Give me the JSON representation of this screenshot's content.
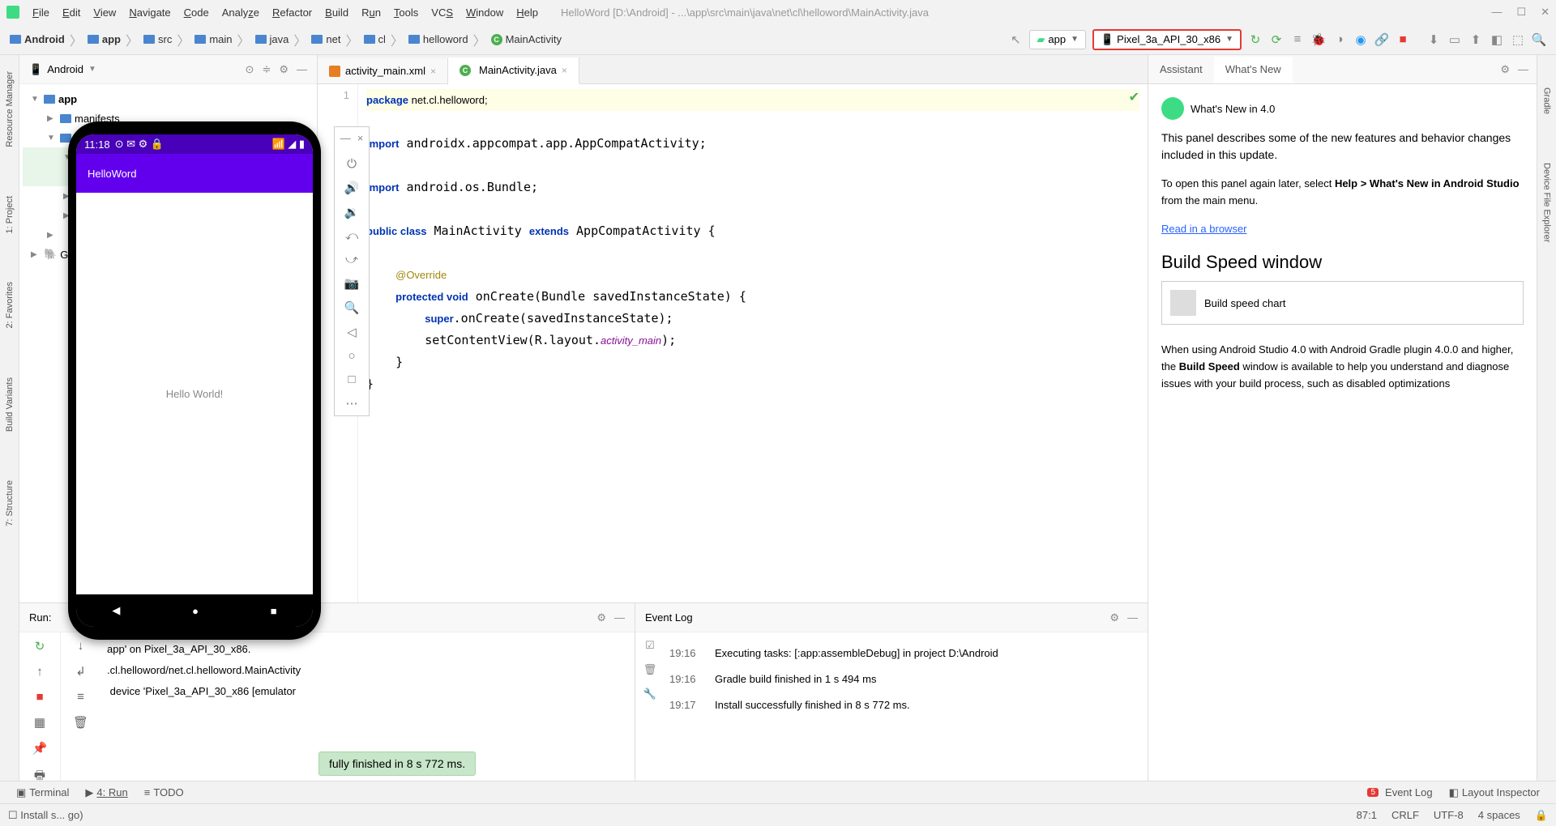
{
  "window": {
    "title": "HelloWord [D:\\Android] - ...\\app\\src\\main\\java\\net\\cl\\helloword\\MainActivity.java"
  },
  "menu": [
    "File",
    "Edit",
    "View",
    "Navigate",
    "Code",
    "Analyze",
    "Refactor",
    "Build",
    "Run",
    "Tools",
    "VCS",
    "Window",
    "Help"
  ],
  "breadcrumbs": [
    "Android",
    "app",
    "src",
    "main",
    "java",
    "net",
    "cl",
    "helloword",
    "MainActivity"
  ],
  "run_config": {
    "app": "app",
    "device": "Pixel_3a_API_30_x86"
  },
  "project": {
    "view": "Android",
    "root": "app",
    "manifests": "manifests"
  },
  "tabs": {
    "xml": "activity_main.xml",
    "java": "MainActivity.java"
  },
  "code": {
    "line1": "package net.cl.helloword;",
    "imp1": "import androidx.appcompat.app.AppCompatActivity;",
    "imp2": "import android.os.Bundle;",
    "cls": "public class MainActivity extends AppCompatActivity {",
    "ov": "@Override",
    "oc": "protected void onCreate(Bundle savedInstanceState) {",
    "sup": "super.onCreate(savedInstanceState);",
    "scv1": "setContentView(R.layout.",
    "scv2": "activity_main",
    "scv3": ");"
  },
  "gutter": "1",
  "whats_new": {
    "tab1": "Assistant",
    "tab2": "What's New",
    "h1": "What's New in 4.0",
    "p1": "This panel describes some of the new features and behavior changes included in this update.",
    "p2a": "To open this panel again later, select ",
    "p2b": "Help > What's New in Android Studio",
    "p2c": " from the main menu.",
    "link": "Read in a browser",
    "h2": "Build Speed window",
    "chart": "Build speed chart",
    "p3a": "When using Android Studio 4.0 with Android Gradle plugin 4.0.0 and higher, the ",
    "p3b": "Build Speed",
    "p3c": " window is available to help you understand and diagnose issues with your build process, such as disabled optimizations"
  },
  "run": {
    "title": "Run:",
    "l1": "app' on Pixel_3a_API_30_x86.",
    "l2": ".cl.helloword/net.cl.helloword.MainActivity",
    "l3": " device 'Pixel_3a_API_30_x86 [emulator"
  },
  "toast": "fully finished in 8 s 772 ms.",
  "eventlog": {
    "title": "Event Log",
    "rows": [
      {
        "t": "19:16",
        "m": "Executing tasks: [:app:assembleDebug] in project D:\\Android"
      },
      {
        "t": "19:16",
        "m": "Gradle build finished in 1 s 494 ms"
      },
      {
        "t": "19:17",
        "m": "Install successfully finished in 8 s 772 ms."
      }
    ]
  },
  "phone": {
    "time": "11:18",
    "app": "HelloWord",
    "text": "Hello World!"
  },
  "bottombar": {
    "run": "4: Run",
    "todo": "TODO",
    "elog": "Event Log",
    "layout": "Layout Inspector",
    "term": "Terminal"
  },
  "status": {
    "msg": "Install successfully finished (moments ago)",
    "pos": "87:1",
    "le": "CRLF",
    "enc": "UTF-8",
    "ind": "4 spaces"
  },
  "left_rail": [
    "Resource Manager",
    "1: Project",
    "2: Favorites",
    "Build Variants",
    "7: Structure"
  ],
  "right_rail": [
    "Gradle",
    "Device File Explorer"
  ]
}
